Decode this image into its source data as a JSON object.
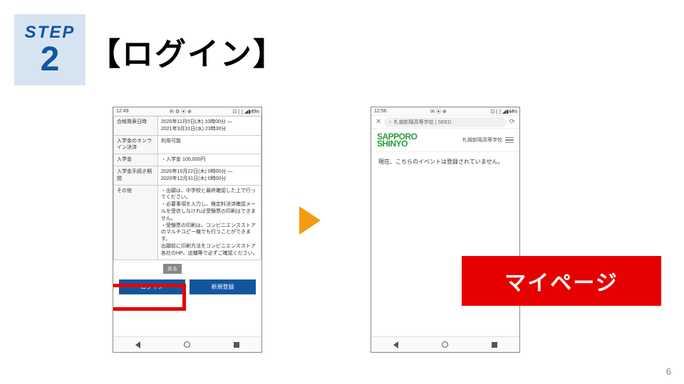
{
  "step": {
    "label": "STEP",
    "number": "2"
  },
  "title": "【ログイン】",
  "leftPhone": {
    "status": {
      "time": "12:49",
      "iconsL": "✉ ⚙ ⦿ ⊕",
      "iconsR": "⊡ ❘❘ ◢ ▮ 45%"
    },
    "rows": {
      "announce": {
        "label": "合格発表日時",
        "value": "2020年11月5日(木) 10時00分 —\n2021年3月31日(水) 23時30分"
      },
      "online": {
        "label": "入学金のオンライン決済",
        "value": "利用可能"
      },
      "fee": {
        "label": "入学金",
        "value": "・入学金 100,000円"
      },
      "period": {
        "label": "入学金手続き期間",
        "value": "2020年10月22日(木) 0時00分 —\n2020年12月31日(木) 0時00分"
      },
      "other": {
        "label": "その他",
        "value": "・出願は、中学校と最終確認した上で行ってください。\n・必要事項を入力し、検定料決済確認メールを受信しなければ受験票の印刷はできません。\n・受験票の印刷は、コンビニエンスストアのマルチコピー機でも行うことができます。\n  出願前に印刷方法をコンビニエンスストア各社のHP、店舗等で必ずご確認ください。"
      }
    },
    "grayBtn": "戻る",
    "loginBtn": "ログイン",
    "registerBtn": "新規登録"
  },
  "rightPhone": {
    "status": {
      "time": "12:56",
      "iconsL": "✉ ⦿ ⊕",
      "iconsR": "⊡ ❘❘ ◢ ▮ 44%"
    },
    "url": "札幌新陽高等学校 | SEED",
    "logo": {
      "l1": "SAPPORO",
      "l2": "SHINYO"
    },
    "schoolSmall": "札幌新陽高等学校",
    "emptyMsg": "現在、こちらのイベントは登録されていません。"
  },
  "mypageLabel": "マイページ",
  "pageNumber": "6"
}
